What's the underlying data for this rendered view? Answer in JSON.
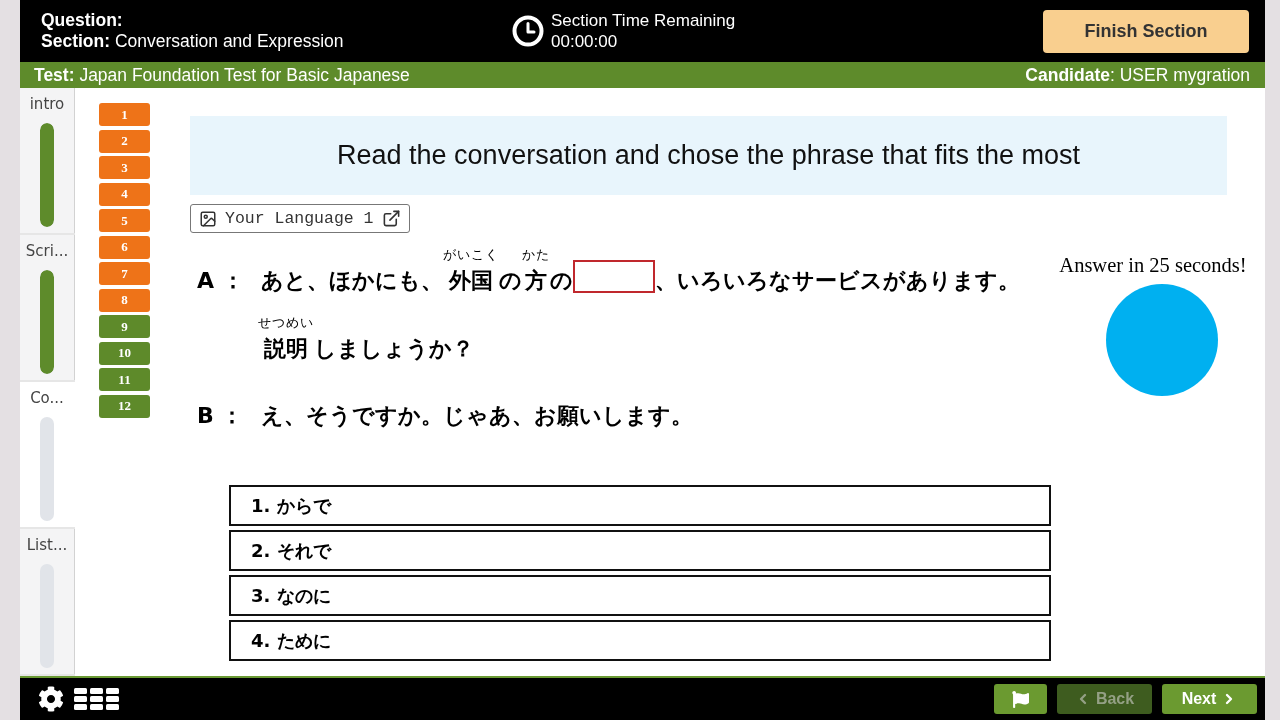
{
  "header": {
    "question_label": "Question:",
    "section": "**Section:** Conversation and Expression",
    "timer_label": "Section Time Remaining",
    "timer_value": "00:00:00",
    "finish_button": "Finish Section"
  },
  "info_bar": {
    "test": "**Test:** Japan Foundation Test for Basic Japanese",
    "candidate": "**Candidate**: USER mygration"
  },
  "sections": [
    {
      "label": "intro",
      "selected": false,
      "level": 1
    },
    {
      "label": "Scri...",
      "selected": false,
      "level": 1
    },
    {
      "label": "Co...",
      "selected": true,
      "level": 0
    },
    {
      "label": "List...",
      "selected": false,
      "level": 0
    }
  ],
  "question_numbers": [
    {
      "label": "1",
      "color": "#ee7318"
    },
    {
      "label": "2",
      "color": "#ee7318"
    },
    {
      "label": "3",
      "color": "#ee7318"
    },
    {
      "label": "4",
      "color": "#ee7318"
    },
    {
      "label": "5",
      "color": "#ee7318"
    },
    {
      "label": "6",
      "color": "#ee7318"
    },
    {
      "label": "7",
      "color": "#ee7318"
    },
    {
      "label": "8",
      "color": "#ee7318"
    },
    {
      "label": "9",
      "color": "#5e8a2a"
    },
    {
      "label": "10",
      "color": "#5e8a2a"
    },
    {
      "label": "11",
      "color": "#5e8a2a"
    },
    {
      "label": "12",
      "color": "#5e8a2a"
    }
  ],
  "instruction": "Read the conversation and chose the phrase that fits the most",
  "language_button": "Your Language 1",
  "dialogue": [
    {
      "speaker": "A ：",
      "lines": [
        {
          "segments": [
            {
              "kind": "text",
              "text": "あと、ほかにも、"
            },
            {
              "kind": "ruby",
              "text": "外国",
              "ruby": "がいこく"
            },
            {
              "kind": "text",
              "text": "の"
            },
            {
              "kind": "ruby",
              "text": "方",
              "ruby": "かた"
            },
            {
              "kind": "text",
              "text": "の"
            },
            {
              "kind": "blank"
            },
            {
              "kind": "text",
              "text": "、いろいろなサービスがあります。"
            }
          ]
        },
        {
          "segments": [
            {
              "kind": "ruby",
              "text": "説明",
              "ruby": "せつめい"
            },
            {
              "kind": "text",
              "text": "しましょうか？"
            }
          ]
        }
      ]
    },
    {
      "speaker": "B ：",
      "lines": [
        {
          "segments": [
            {
              "kind": "text",
              "text": "え、そうですか。じゃあ、お願いします。"
            }
          ]
        }
      ]
    }
  ],
  "answer_timer": {
    "text": "Answer in 25 seconds!"
  },
  "options": [
    {
      "label": "1. からで",
      "selected": false
    },
    {
      "label": "2. それで",
      "selected": false
    },
    {
      "label": "3. なのに",
      "selected": false
    },
    {
      "label": "4. ために",
      "selected": false
    }
  ],
  "footer": {
    "buttons": [
      {
        "kind": "back",
        "label": "Back",
        "disabled": true
      },
      {
        "kind": "next",
        "label": "Next",
        "disabled": false
      }
    ]
  }
}
